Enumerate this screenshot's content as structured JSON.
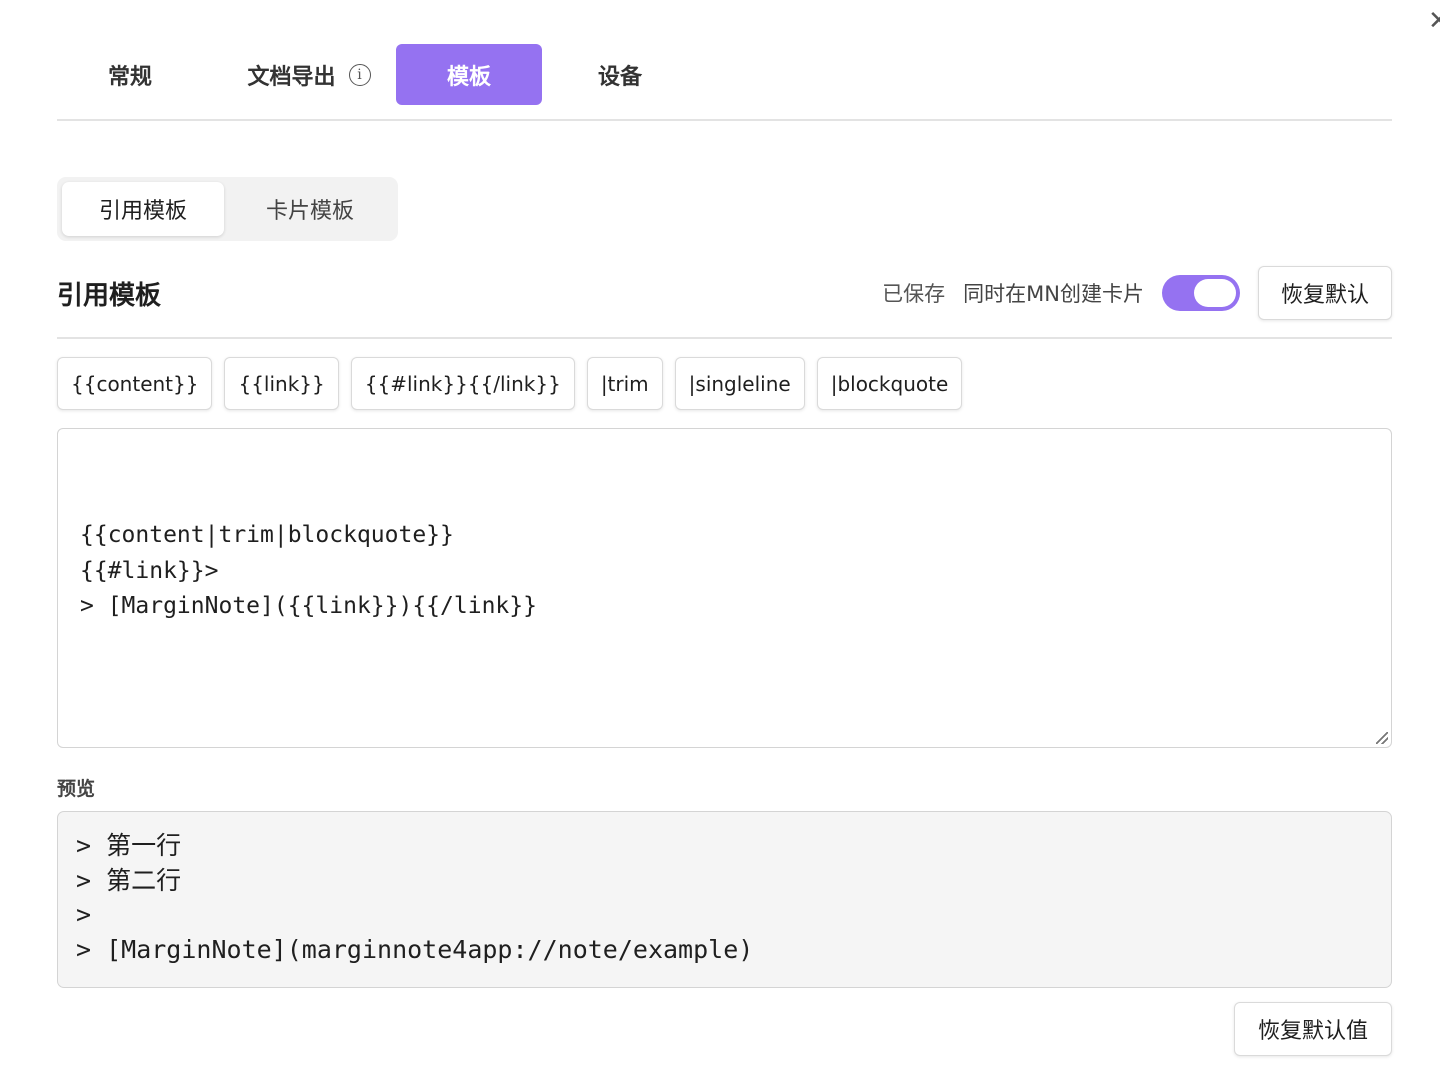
{
  "window": {
    "close_glyph": "✕"
  },
  "tabs": [
    {
      "label": "常规",
      "active": false
    },
    {
      "label": "文档导出",
      "active": false,
      "info_icon": "i"
    },
    {
      "label": "模板",
      "active": true
    },
    {
      "label": "设备",
      "active": false
    }
  ],
  "segment": {
    "items": [
      {
        "label": "引用模板",
        "active": true
      },
      {
        "label": "卡片模板",
        "active": false
      }
    ]
  },
  "section": {
    "title": "引用模板",
    "saved_status": "已保存",
    "sync_label": "同时在MN创建卡片",
    "toggle_on": true,
    "reset_label": "恢复默认"
  },
  "chips": [
    "{{content}}",
    "{{link}}",
    "{{#link}}{{/link}}",
    "|trim",
    "|singleline",
    "|blockquote"
  ],
  "editor": {
    "value": "{{content|trim|blockquote}}\n{{#link}}>\n> [MarginNote]({{link}}){{/link}}"
  },
  "preview": {
    "label": "预览",
    "lines": [
      "> 第一行",
      "> 第二行",
      ">",
      "> [MarginNote](marginnote4app://note/example)"
    ]
  },
  "footer": {
    "restore_defaults_label": "恢复默认值"
  },
  "colors": {
    "accent": "#9572f1",
    "border": "#d4d4d4",
    "preview_bg": "#f5f5f5"
  }
}
